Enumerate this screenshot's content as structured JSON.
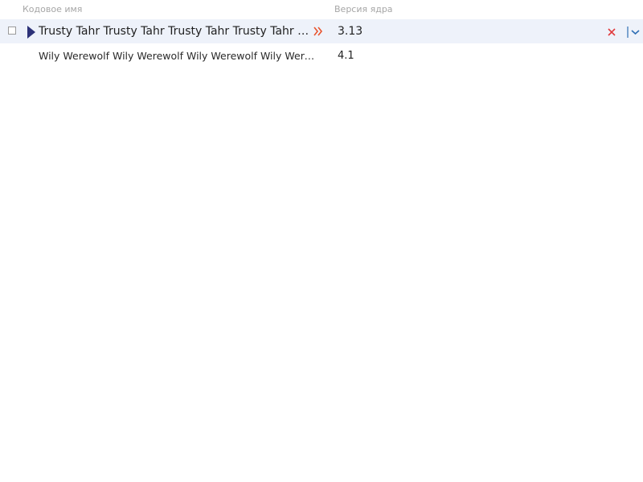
{
  "table": {
    "columns": [
      {
        "label": "Кодовое имя"
      },
      {
        "label": "Версия ядра"
      }
    ],
    "rows": [
      {
        "code_name": "Trusty Tahr Trusty Tahr Trusty Tahr Trusty Tahr Trusty Tahr",
        "kernel_version": "3.13",
        "selected": true
      },
      {
        "code_name": "Wily Werewolf Wily Werewolf Wily Werewolf Wily Werewolf Wily Werewolf",
        "kernel_version": "4.1",
        "selected": false
      }
    ]
  },
  "colors": {
    "selected_row_bg": "#eef2fa",
    "row_marker": "#2d3278",
    "expand_icon": "#e8542e",
    "delete_icon": "#e0393b",
    "menu_icon": "#2f6fb5",
    "header_text": "#a6a6a6"
  },
  "icons": {
    "row_marker": "triangle-right-icon",
    "expand": "double-chevron-right-icon",
    "delete": "close-icon",
    "menu": "chevron-down-icon"
  }
}
